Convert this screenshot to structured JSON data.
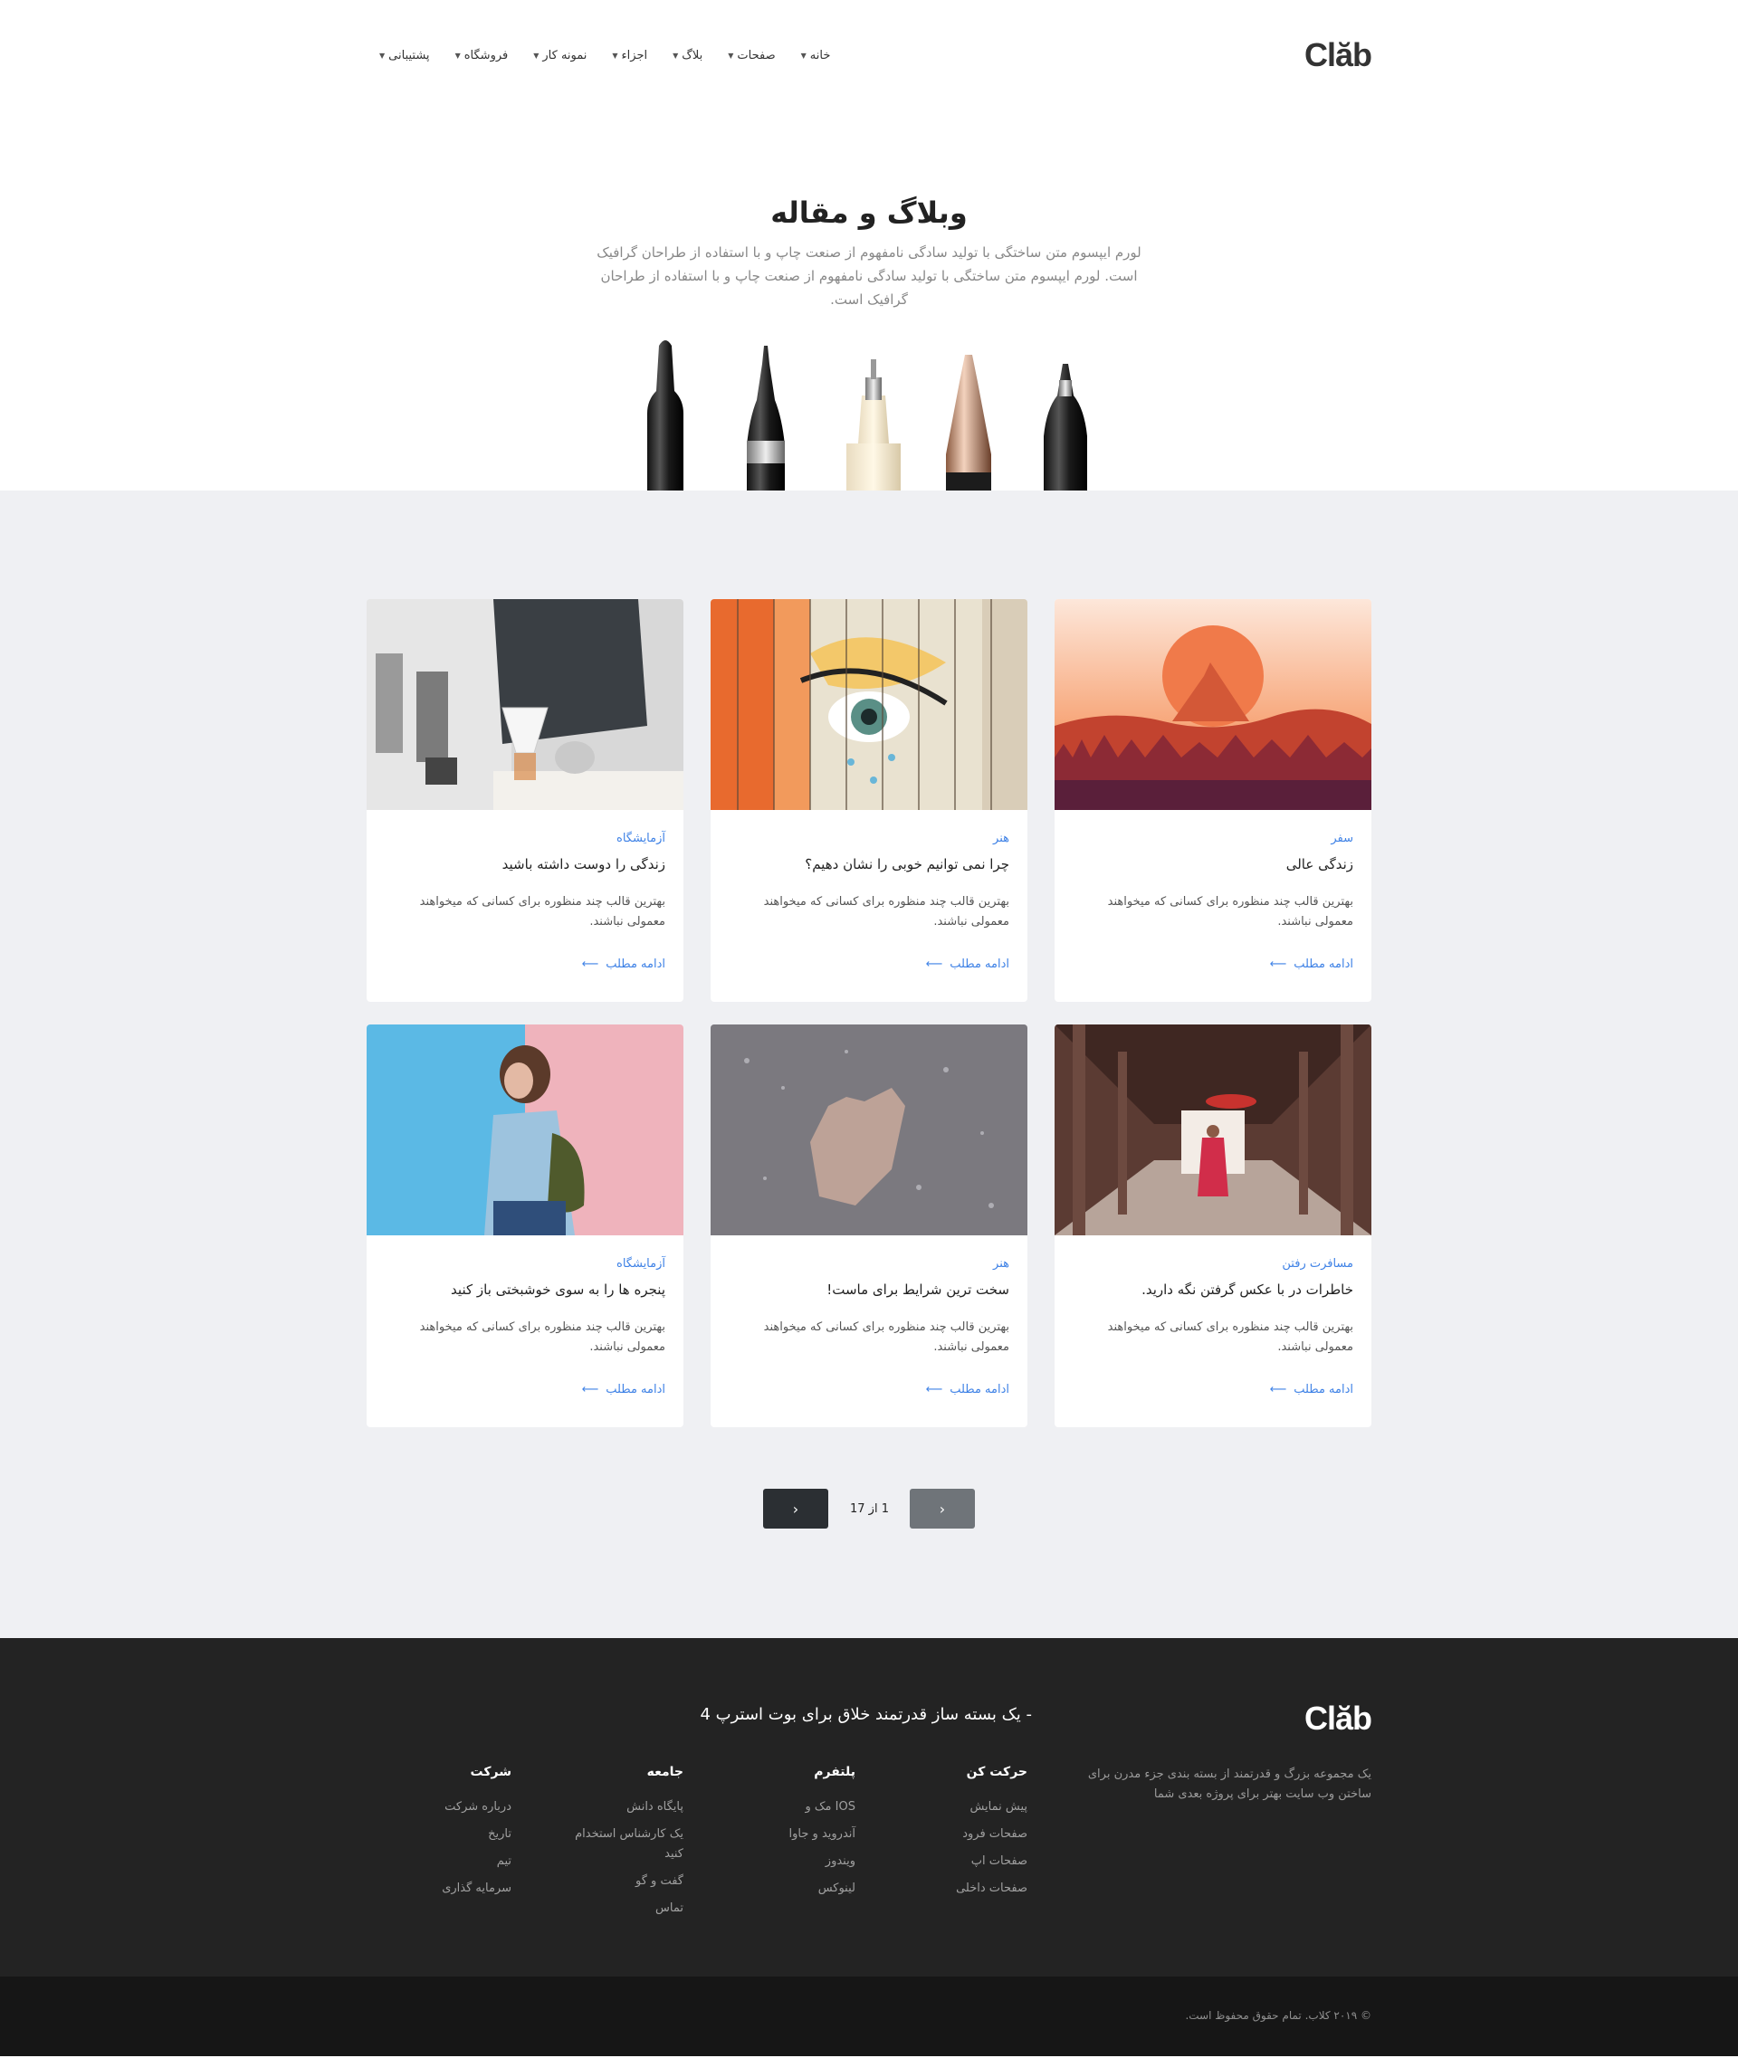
{
  "header": {
    "logo": "Clăb",
    "nav": [
      {
        "label": "خانه"
      },
      {
        "label": "صفحات"
      },
      {
        "label": "بلاگ"
      },
      {
        "label": "اجزاء"
      },
      {
        "label": "نمونه کار"
      },
      {
        "label": "فروشگاه"
      },
      {
        "label": "پشتیبانی"
      }
    ]
  },
  "hero": {
    "title": "وبلاگ و مقاله",
    "text": "لورم ایپسوم متن ساختگی با تولید سادگی نامفهوم از صنعت چاپ و با استفاده از طراحان گرافیک است. لورم ایپسوم متن ساختگی با تولید سادگی نامفهوم از صنعت چاپ و با استفاده از طراحان گرافیک است."
  },
  "posts": [
    {
      "category": "سفر",
      "title": "زندگی عالی",
      "excerpt": "بهترین قالب چند منظوره برای کسانی که میخواهند معمولی نباشند.",
      "more": "ادامه مطلب"
    },
    {
      "category": "هنر",
      "title": "چرا نمی توانیم خوبی را نشان دهیم؟",
      "excerpt": "بهترین قالب چند منظوره برای کسانی که میخواهند معمولی نباشند.",
      "more": "ادامه مطلب"
    },
    {
      "category": "آزمایشگاه",
      "title": "زندگی را دوست داشته باشید",
      "excerpt": "بهترین قالب چند منظوره برای کسانی که میخواهند معمولی نباشند.",
      "more": "ادامه مطلب"
    },
    {
      "category": "مسافرت رفتن",
      "title": "خاطرات در با عکس گرفتن نگه دارید.",
      "excerpt": "بهترین قالب چند منظوره برای کسانی که میخواهند معمولی نباشند.",
      "more": "ادامه مطلب"
    },
    {
      "category": "هنر",
      "title": "سخت ترین شرایط برای ماست!",
      "excerpt": "بهترین قالب چند منظوره برای کسانی که میخواهند معمولی نباشند.",
      "more": "ادامه مطلب"
    },
    {
      "category": "آزمایشگاه",
      "title": "پنجره ها را به سوی خوشبختی باز کنید",
      "excerpt": "بهترین قالب چند منظوره برای کسانی که میخواهند معمولی نباشند.",
      "more": "ادامه مطلب"
    }
  ],
  "pagination": {
    "info": "1 از 17"
  },
  "footer": {
    "logo": "Clăb",
    "tagline": "- یک بسته ساز قدرتمند خلاق برای بوت استرپ 4",
    "description": "یک مجموعه بزرگ و قدرتمند از بسته بندی جزء مدرن برای ساختن وب سایت بهتر برای پروژه بعدی شما",
    "columns": [
      {
        "title": "حرکت کن",
        "links": [
          "پیش نمایش",
          "صفحات فرود",
          "صفحات اپ",
          "صفحات داخلی"
        ]
      },
      {
        "title": "پلتفرم",
        "links": [
          "IOS مک و",
          "آندروید و جاوا",
          "ویندوز",
          "لینوکس"
        ]
      },
      {
        "title": "جامعه",
        "links": [
          "پایگاه دانش",
          "یک کارشناس استخدام کنید",
          "گفت و گو",
          "تماس"
        ]
      },
      {
        "title": "شرکت",
        "links": [
          "درباره شرکت",
          "تاریخ",
          "تیم",
          "سرمایه گذاری"
        ]
      }
    ],
    "copyright": "© ۲۰۱۹ کلاب. تمام حقوق محفوظ است."
  }
}
